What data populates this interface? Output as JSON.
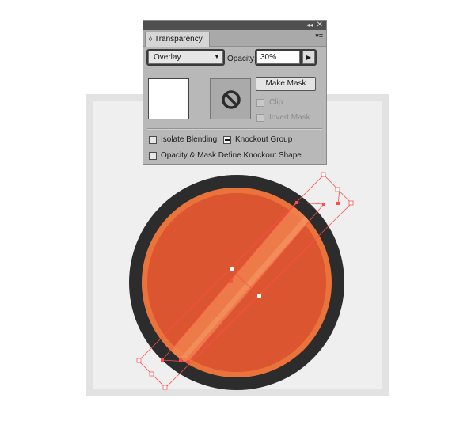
{
  "panel": {
    "collapse_glyph": "◂◂",
    "close_glyph": "✕",
    "tab_label": "Transparency",
    "tab_arrows": "◊",
    "menu_glyph": "▾≡",
    "blend_mode": "Overlay",
    "dropdown_glyph": "▼",
    "opacity_label": "Opacity:",
    "opacity_value": "30%",
    "opacity_arrow_glyph": "▶",
    "make_mask_label": "Make Mask",
    "clip_label": "Clip",
    "invert_mask_label": "Invert Mask",
    "isolate_blending_label": "Isolate Blending",
    "knockout_group_label": "Knockout Group",
    "opacity_mask_label": "Opacity & Mask Define Knockout Shape"
  },
  "icons": {
    "mask_thumbnail": "no-mask-icon",
    "dropdown": "chevron-down-icon",
    "stepper": "play-arrow-icon"
  },
  "colors": {
    "artboard": "#efefef",
    "artboard_border": "#e2e2e2",
    "outer_ring": "#2c2c2c",
    "inner_ring": "#e9733a",
    "fill": "#db5530",
    "stripe": "#f0834e",
    "selection": "#ff4d4d",
    "panel_bg": "#b8b8b8",
    "focus_ring": "#3a3a3a"
  }
}
